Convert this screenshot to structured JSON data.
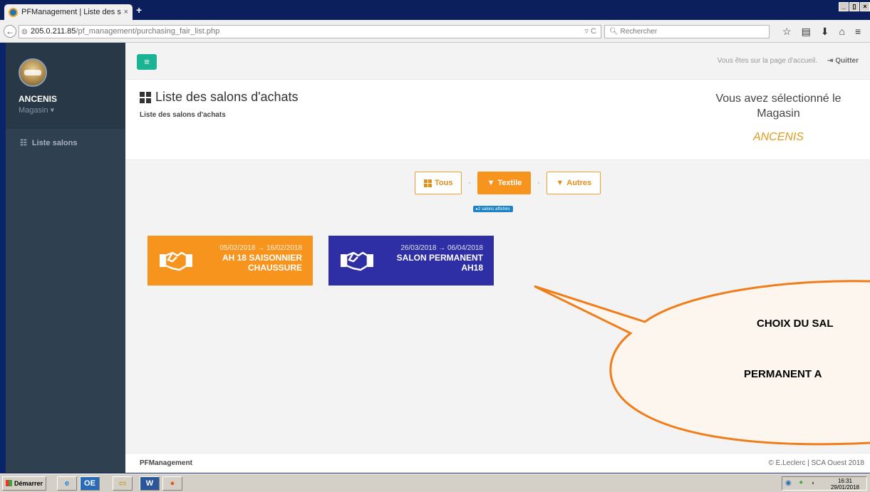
{
  "browser": {
    "tab_title": "PFManagement | Liste des sal...",
    "tab_close": "×",
    "new_tab": "+",
    "url_host": "205.0.211.85",
    "url_path": "/pf_management/purchasing_fair_list.php",
    "reload": "▿ C",
    "search_placeholder": "Rechercher",
    "window_buttons": [
      "_",
      "▯",
      "×"
    ]
  },
  "sidebar": {
    "user_name": "ANCENIS",
    "user_role": "Magasin ▾",
    "items": [
      {
        "label": "Liste salons"
      }
    ]
  },
  "topbar": {
    "menu_label": "≡",
    "welcome": "Vous êtes sur la page d'accueil.",
    "quit": "Quitter"
  },
  "page": {
    "title": "Liste des salons d'achats",
    "breadcrumb": "Liste des salons d'achats",
    "selected_line1": "Vous avez sélectionné le",
    "selected_line2": "Magasin",
    "selected_store": "ANCENIS"
  },
  "filters": {
    "all": "Tous",
    "textile": "Textile",
    "others": "Autres",
    "count_badge": "▸2 salons affichés"
  },
  "fairs": [
    {
      "dates": "05/02/2018 → 16/02/2018",
      "name_line1": "AH 18 SAISONNIER",
      "name_line2": "CHAUSSURE",
      "color": "#f7941d"
    },
    {
      "dates": "26/03/2018 → 06/04/2018",
      "name_line1": "SALON PERMANENT",
      "name_line2": "AH18",
      "color": "#2f2fa5"
    }
  ],
  "footer": {
    "left": "PFManagement",
    "right": "© E.Leclerc | SCA Ouest 2018"
  },
  "callout": {
    "line1": "CHOIX DU SAL",
    "line2": "PERMANENT A"
  },
  "taskbar": {
    "start": "Démarrer",
    "apps": [
      "e",
      "OE",
      "▭",
      "W",
      "●"
    ],
    "time": "16:31",
    "date": "29/01/2018"
  },
  "colors": {
    "accent_green": "#1ab394",
    "orange": "#f7941d",
    "blue_card": "#2f2fa5",
    "sidebar": "#2f4050"
  }
}
